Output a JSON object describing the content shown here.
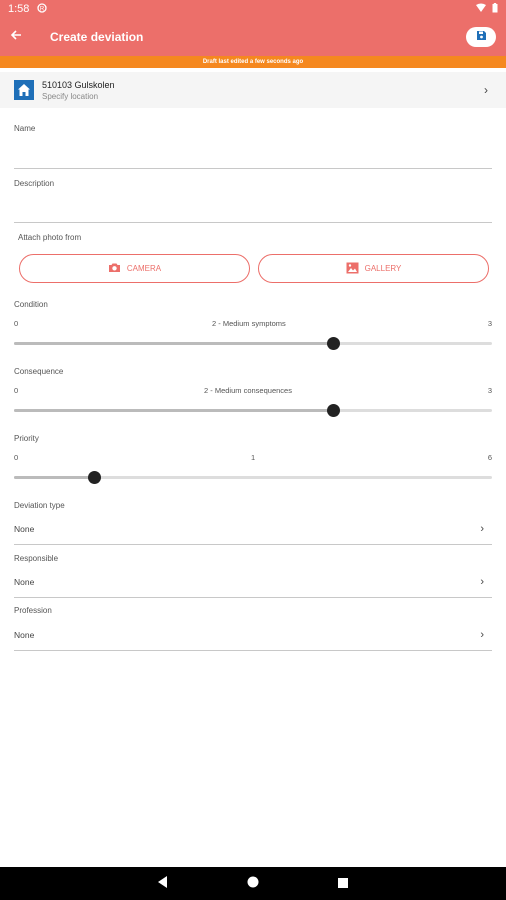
{
  "status_bar": {
    "time": "1:58"
  },
  "app_bar": {
    "title": "Create deviation"
  },
  "draft_notice": "Draft last edited a few seconds ago",
  "location": {
    "name": "510103 Gulskolen",
    "subtitle": "Specify location"
  },
  "fields": {
    "name_label": "Name",
    "name_value": "",
    "description_label": "Description",
    "description_value": ""
  },
  "attach": {
    "label": "Attach photo from",
    "camera_label": "CAMERA",
    "gallery_label": "GALLERY"
  },
  "sliders": [
    {
      "label": "Condition",
      "min": "0",
      "max": "3",
      "value": 2,
      "value_text": "2 - Medium symptoms"
    },
    {
      "label": "Consequence",
      "min": "0",
      "max": "3",
      "value": 2,
      "value_text": "2 - Medium consequences"
    },
    {
      "label": "Priority",
      "min": "0",
      "max": "6",
      "value": 1,
      "value_text": "1"
    }
  ],
  "selects": [
    {
      "label": "Deviation type",
      "value": "None"
    },
    {
      "label": "Responsible",
      "value": "None"
    },
    {
      "label": "Profession",
      "value": "None"
    }
  ],
  "colors": {
    "primary": "#ec6f6a",
    "draft_bar": "#f5881f",
    "location_icon": "#1e6fb8"
  },
  "icons": [
    "back-arrow-icon",
    "save-icon",
    "home-icon",
    "chevron-right-icon",
    "camera-icon",
    "gallery-icon",
    "nav-back-icon",
    "nav-home-icon",
    "nav-recents-icon"
  ]
}
